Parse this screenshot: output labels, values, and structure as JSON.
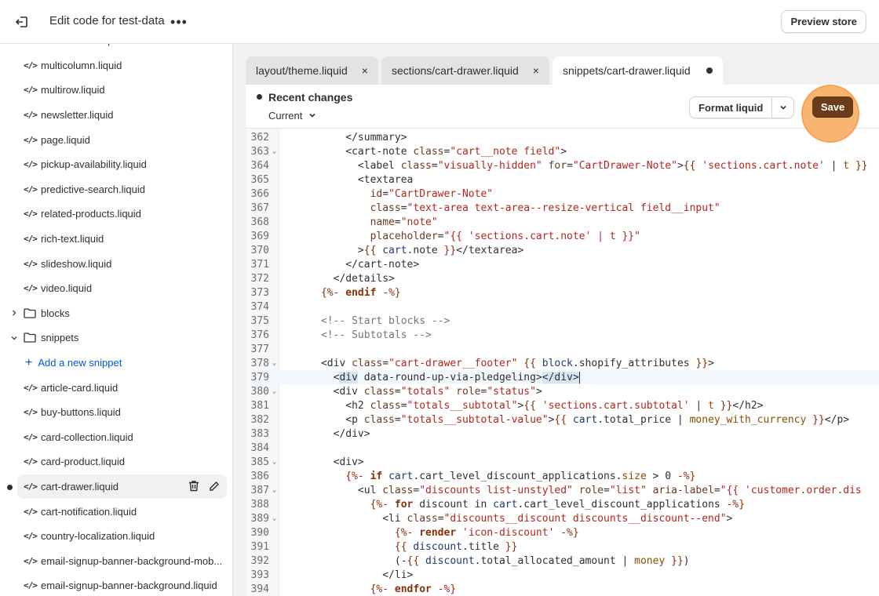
{
  "header": {
    "title": "Edit code for test-data",
    "more_label": "•••",
    "preview_label": "Preview store"
  },
  "sidebar": {
    "files_top": [
      "main-search.liquid",
      "multicolumn.liquid",
      "multirow.liquid",
      "newsletter.liquid",
      "page.liquid",
      "pickup-availability.liquid",
      "predictive-search.liquid",
      "related-products.liquid",
      "rich-text.liquid",
      "slideshow.liquid",
      "video.liquid"
    ],
    "folder_blocks": "blocks",
    "folder_snippets": "snippets",
    "add_snippet": "Add a new snippet",
    "snippets": [
      "article-card.liquid",
      "buy-buttons.liquid",
      "card-collection.liquid",
      "card-product.liquid",
      "cart-drawer.liquid",
      "cart-notification.liquid",
      "country-localization.liquid",
      "email-signup-banner-background-mob...",
      "email-signup-banner-background.liquid"
    ],
    "code_icon": "</>"
  },
  "tabs": [
    {
      "label": "layout/theme.liquid",
      "close": "×"
    },
    {
      "label": "sections/cart-drawer.liquid",
      "close": "×"
    },
    {
      "prefix": "snippets/",
      "label": "cart-drawer.liquid"
    }
  ],
  "editor": {
    "recent_title": "Recent changes",
    "version_select": "Current",
    "format_label": "Format liquid",
    "save_label": "Save"
  },
  "colors": {
    "save_bg": "#6b3b1a",
    "save_highlight": "#f8b26a",
    "link": "#005bd3"
  },
  "code": [
    {
      "n": "362",
      "fold": false,
      "html": "          &lt;/summary&gt;"
    },
    {
      "n": "363",
      "fold": true,
      "html": "          &lt;cart-note <span class='c-attr'>class</span>=<span class='c-str'>\"cart__note field\"</span>&gt;"
    },
    {
      "n": "364",
      "fold": false,
      "html": "            &lt;label <span class='c-attr'>class</span>=<span class='c-str'>\"visually-hidden\"</span> <span class='c-attr'>for</span>=<span class='c-str'>\"CartDrawer-Note\"</span>&gt;<span class='c-del'>{{</span> <span class='c-str'>'sections.cart.note'</span> | <span class='c-filter'>t</span> <span class='c-del'>}}</span>"
    },
    {
      "n": "365",
      "fold": false,
      "html": "            &lt;textarea"
    },
    {
      "n": "366",
      "fold": false,
      "html": "              <span class='c-attr'>id</span>=<span class='c-str'>\"CartDrawer-Note\"</span>"
    },
    {
      "n": "367",
      "fold": false,
      "html": "              <span class='c-attr'>class</span>=<span class='c-str'>\"text-area text-area--resize-vertical field__input\"</span>"
    },
    {
      "n": "368",
      "fold": false,
      "html": "              <span class='c-attr'>name</span>=<span class='c-str'>\"note\"</span>"
    },
    {
      "n": "369",
      "fold": false,
      "html": "              <span class='c-attr'>placeholder</span>=<span class='c-str'>\"{{ 'sections.cart.note' | t }}\"</span>"
    },
    {
      "n": "370",
      "fold": false,
      "html": "            &gt;<span class='c-del'>{{</span> <span class='c-var'>cart</span>.note <span class='c-del'>}}</span>&lt;/textarea&gt;"
    },
    {
      "n": "371",
      "fold": false,
      "html": "          &lt;/cart-note&gt;"
    },
    {
      "n": "372",
      "fold": false,
      "html": "        &lt;/details&gt;"
    },
    {
      "n": "373",
      "fold": false,
      "html": "      <span class='c-del'>{%-</span> <span class='c-kw'>endif</span> <span class='c-del'>-%}</span>"
    },
    {
      "n": "374",
      "fold": false,
      "html": ""
    },
    {
      "n": "375",
      "fold": false,
      "html": "      <span class='c-com'>&lt;!-- Start blocks --&gt;</span>"
    },
    {
      "n": "376",
      "fold": false,
      "html": "      <span class='c-com'>&lt;!-- Subtotals --&gt;</span>"
    },
    {
      "n": "377",
      "fold": false,
      "html": ""
    },
    {
      "n": "378",
      "fold": true,
      "html": "      &lt;div <span class='c-attr'>class</span>=<span class='c-str'>\"cart-drawer__footer\"</span> <span class='c-del'>{{</span> <span class='c-var'>block</span>.shopify_attributes <span class='c-del'>}}</span>&gt;"
    },
    {
      "n": "379",
      "fold": false,
      "cur": true,
      "html": "        &lt;<span class='cursor-hl'>div</span> data-round-up-via-pledgeling&gt;<span class='cursor-hl'>&lt;/div&gt;</span><span class='caret-line'></span>"
    },
    {
      "n": "380",
      "fold": true,
      "html": "        &lt;div <span class='c-attr'>class</span>=<span class='c-str'>\"totals\"</span> <span class='c-attr'>role</span>=<span class='c-str'>\"status\"</span>&gt;"
    },
    {
      "n": "381",
      "fold": false,
      "html": "          &lt;h2 <span class='c-attr'>class</span>=<span class='c-str'>\"totals__subtotal\"</span>&gt;<span class='c-del'>{{</span> <span class='c-str'>'sections.cart.subtotal'</span> | <span class='c-filter'>t</span> <span class='c-del'>}}</span>&lt;/h2&gt;"
    },
    {
      "n": "382",
      "fold": false,
      "html": "          &lt;p <span class='c-attr'>class</span>=<span class='c-str'>\"totals__subtotal-value\"</span>&gt;<span class='c-del'>{{</span> <span class='c-var'>cart</span>.total_price | <span class='c-filter'>money_with_currency</span> <span class='c-del'>}}</span>&lt;/p&gt;"
    },
    {
      "n": "383",
      "fold": false,
      "html": "        &lt;/div&gt;"
    },
    {
      "n": "384",
      "fold": false,
      "html": ""
    },
    {
      "n": "385",
      "fold": true,
      "html": "        &lt;div&gt;"
    },
    {
      "n": "386",
      "fold": false,
      "html": "          <span class='c-del'>{%-</span> <span class='c-kw'>if</span> <span class='c-var'>cart</span>.cart_level_discount_applications.<span class='c-filter'>size</span> &gt; 0 <span class='c-del'>-%}</span>"
    },
    {
      "n": "387",
      "fold": true,
      "html": "            &lt;ul <span class='c-attr'>class</span>=<span class='c-str'>\"discounts list-unstyled\"</span> <span class='c-attr'>role</span>=<span class='c-str'>\"list\"</span> <span class='c-attr'>aria-label</span>=<span class='c-str'>\"{{ 'customer.order.dis</span>"
    },
    {
      "n": "388",
      "fold": false,
      "html": "              <span class='c-del'>{%-</span> <span class='c-kw'>for</span> discount in <span class='c-var'>cart</span>.cart_level_discount_applications <span class='c-del'>-%}</span>"
    },
    {
      "n": "389",
      "fold": true,
      "html": "                &lt;li <span class='c-attr'>class</span>=<span class='c-str'>\"discounts__discount discounts__discount--end\"</span>&gt;"
    },
    {
      "n": "390",
      "fold": false,
      "html": "                  <span class='c-del'>{%-</span> <span class='c-kw'>render</span> <span class='c-str'>'icon-discount'</span> <span class='c-del'>-%}</span>"
    },
    {
      "n": "391",
      "fold": false,
      "html": "                  <span class='c-del'>{{</span> <span class='c-var'>discount</span>.title <span class='c-del'>}}</span>"
    },
    {
      "n": "392",
      "fold": false,
      "html": "                  (-<span class='c-del'>{{</span> <span class='c-var'>discount</span>.total_allocated_amount | <span class='c-filter'>money</span> <span class='c-del'>}}</span>)"
    },
    {
      "n": "393",
      "fold": false,
      "html": "                &lt;/li&gt;"
    },
    {
      "n": "394",
      "fold": false,
      "html": "              <span class='c-del'>{%-</span> <span class='c-kw'>endfor</span> <span class='c-del'>-%}</span>"
    }
  ]
}
